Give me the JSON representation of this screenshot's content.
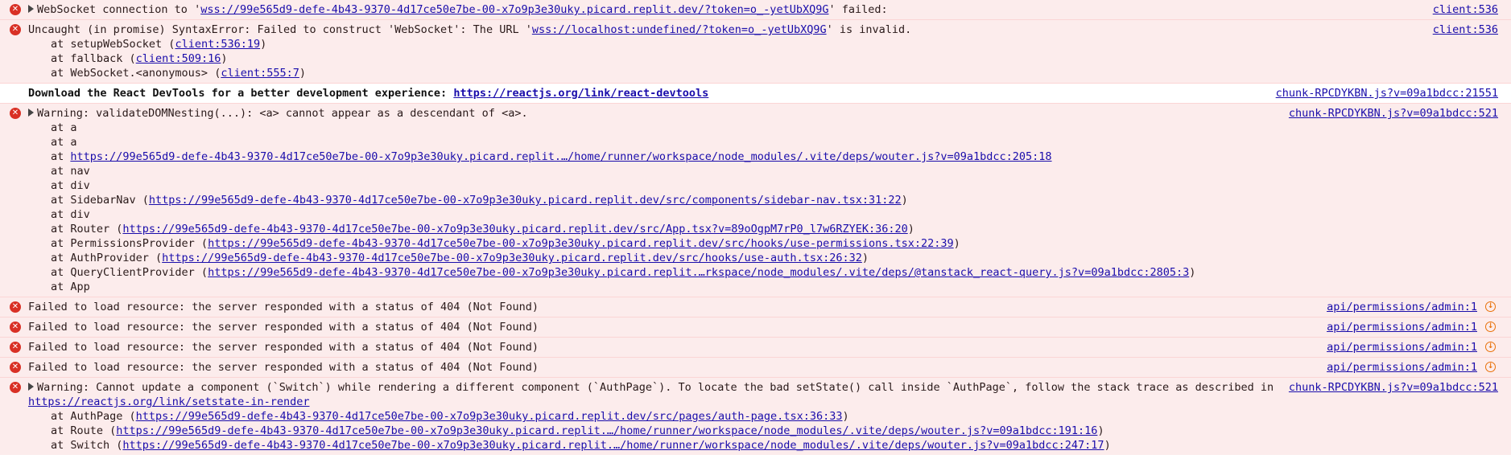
{
  "messages": [
    {
      "kind": "err-expandable",
      "prefix": "WebSocket connection to '",
      "link": "wss://99e565d9-defe-4b43-9370-4d17ce50e7be-00-x7o9p3e30uky.picard.replit.dev/?token=o_-yetUbXQ9G",
      "suffix": "' failed:",
      "source": "client:536"
    },
    {
      "kind": "err",
      "prefix": "Uncaught (in promise) SyntaxError: Failed to construct 'WebSocket': The URL '",
      "link": "wss://localhost:undefined/?token=o_-yetUbXQ9G",
      "suffix": "' is invalid.",
      "source": "client:536",
      "frames": [
        {
          "text": "at setupWebSocket (",
          "link": "client:536:19",
          "end": ")"
        },
        {
          "text": "at fallback (",
          "link": "client:509:16",
          "end": ")"
        },
        {
          "text": "at WebSocket.<anonymous> (",
          "link": "client:555:7",
          "end": ")"
        }
      ]
    },
    {
      "kind": "info",
      "prefix": "Download the React DevTools for a better development experience: ",
      "link": "https://reactjs.org/link/react-devtools",
      "source": "chunk-RPCDYKBN.js?v=09a1bdcc:21551"
    },
    {
      "kind": "warn-expandable",
      "prefix": "Warning: validateDOMNesting(...): <a> cannot appear as a descendant of <a>.",
      "source": "chunk-RPCDYKBN.js?v=09a1bdcc:521",
      "frames": [
        {
          "text": "at a"
        },
        {
          "text": "at a"
        },
        {
          "text": "at ",
          "link": "https://99e565d9-defe-4b43-9370-4d17ce50e7be-00-x7o9p3e30uky.picard.replit.…/home/runner/workspace/node_modules/.vite/deps/wouter.js?v=09a1bdcc:205:18"
        },
        {
          "text": "at nav"
        },
        {
          "text": "at div"
        },
        {
          "text": "at SidebarNav (",
          "link": "https://99e565d9-defe-4b43-9370-4d17ce50e7be-00-x7o9p3e30uky.picard.replit.dev/src/components/sidebar-nav.tsx:31:22",
          "end": ")"
        },
        {
          "text": "at div"
        },
        {
          "text": "at Router (",
          "link": "https://99e565d9-defe-4b43-9370-4d17ce50e7be-00-x7o9p3e30uky.picard.replit.dev/src/App.tsx?v=89oOgpM7rP0_l7w6RZYEK:36:20",
          "end": ")"
        },
        {
          "text": "at PermissionsProvider (",
          "link": "https://99e565d9-defe-4b43-9370-4d17ce50e7be-00-x7o9p3e30uky.picard.replit.dev/src/hooks/use-permissions.tsx:22:39",
          "end": ")"
        },
        {
          "text": "at AuthProvider (",
          "link": "https://99e565d9-defe-4b43-9370-4d17ce50e7be-00-x7o9p3e30uky.picard.replit.dev/src/hooks/use-auth.tsx:26:32",
          "end": ")"
        },
        {
          "text": "at QueryClientProvider (",
          "link": "https://99e565d9-defe-4b43-9370-4d17ce50e7be-00-x7o9p3e30uky.picard.replit.…rkspace/node_modules/.vite/deps/@tanstack_react-query.js?v=09a1bdcc:2805:3",
          "end": ")"
        },
        {
          "text": "at App"
        }
      ]
    },
    {
      "kind": "net",
      "prefix": "Failed to load resource: the server responded with a status of 404 (Not Found)",
      "source": "api/permissions/admin:1"
    },
    {
      "kind": "net",
      "prefix": "Failed to load resource: the server responded with a status of 404 (Not Found)",
      "source": "api/permissions/admin:1"
    },
    {
      "kind": "net",
      "prefix": "Failed to load resource: the server responded with a status of 404 (Not Found)",
      "source": "api/permissions/admin:1"
    },
    {
      "kind": "net",
      "prefix": "Failed to load resource: the server responded with a status of 404 (Not Found)",
      "source": "api/permissions/admin:1"
    },
    {
      "kind": "warn-expandable",
      "prefix": "Warning: Cannot update a component (`Switch`) while rendering a different component (`AuthPage`). To locate the bad setState() call inside `AuthPage`, follow the stack trace as described in ",
      "link": "https://reactjs.org/link/setstate-in-render",
      "source": "chunk-RPCDYKBN.js?v=09a1bdcc:521",
      "frames": [
        {
          "text": "at AuthPage (",
          "link": "https://99e565d9-defe-4b43-9370-4d17ce50e7be-00-x7o9p3e30uky.picard.replit.dev/src/pages/auth-page.tsx:36:33",
          "end": ")"
        },
        {
          "text": "at Route (",
          "link": "https://99e565d9-defe-4b43-9370-4d17ce50e7be-00-x7o9p3e30uky.picard.replit.…/home/runner/workspace/node_modules/.vite/deps/wouter.js?v=09a1bdcc:191:16",
          "end": ")"
        },
        {
          "text": "at Switch (",
          "link": "https://99e565d9-defe-4b43-9370-4d17ce50e7be-00-x7o9p3e30uky.picard.replit.…/home/runner/workspace/node_modules/.vite/deps/wouter.js?v=09a1bdcc:247:17",
          "end": ")"
        }
      ]
    }
  ],
  "icons": {
    "error": "error-icon",
    "network": "network-request-icon",
    "expand": "expand-triangle-icon"
  },
  "colors": {
    "error_bg": "#fcecec",
    "error_icon": "#d93025",
    "link": "#1a0dab",
    "network_icon": "#e8710a"
  }
}
